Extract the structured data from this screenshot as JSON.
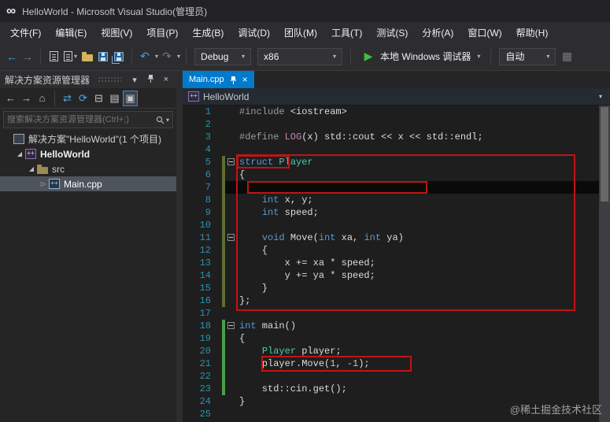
{
  "title_bar": {
    "app_title": "HelloWorld - Microsoft Visual Studio(管理员)"
  },
  "menu_bar": {
    "items": [
      "文件(F)",
      "编辑(E)",
      "视图(V)",
      "项目(P)",
      "生成(B)",
      "调试(D)",
      "团队(M)",
      "工具(T)",
      "测试(S)",
      "分析(A)",
      "窗口(W)",
      "帮助(H)"
    ]
  },
  "toolbar": {
    "debug_dropdown": "Debug",
    "platform_dropdown": "x86",
    "start_button": "本地 Windows 调试器",
    "auto_dropdown": "自动"
  },
  "solution_explorer": {
    "title": "解决方案资源管理器",
    "search_placeholder": "搜索解决方案资源管理器(Ctrl+;)",
    "tree": [
      {
        "id": "solution",
        "label": "解决方案\"HelloWorld\"(1 个项目)",
        "indent": 0,
        "icon": "solution",
        "expander": "none"
      },
      {
        "id": "project-helloworld",
        "label": "HelloWorld",
        "indent": 1,
        "icon": "project",
        "expander": "expanded",
        "bold": true
      },
      {
        "id": "folder-src",
        "label": "src",
        "indent": 2,
        "icon": "folder",
        "expander": "expanded"
      },
      {
        "id": "file-maincpp",
        "label": "Main.cpp",
        "indent": 3,
        "icon": "cpp",
        "expander": "collapsed",
        "selected": true
      }
    ]
  },
  "editor": {
    "tab_label": "Main.cpp",
    "breadcrumb": "HelloWorld",
    "code": {
      "lines": [
        {
          "n": 1,
          "tokens": [
            [
              "pp",
              "#include "
            ],
            [
              "d",
              "<iostream>"
            ]
          ]
        },
        {
          "n": 2,
          "tokens": []
        },
        {
          "n": 3,
          "tokens": [
            [
              "pp",
              "#define "
            ],
            [
              "macro",
              "LOG"
            ],
            [
              "d",
              "(x) std::cout << x << std::endl;"
            ]
          ]
        },
        {
          "n": 4,
          "tokens": []
        },
        {
          "n": 5,
          "fold": true,
          "bar": "b1",
          "tokens": [
            [
              "kw",
              "struct"
            ],
            [
              "d",
              " "
            ],
            [
              "type",
              "Player"
            ]
          ]
        },
        {
          "n": 6,
          "bar": "b1",
          "tokens": [
            [
              "d",
              "{"
            ]
          ]
        },
        {
          "n": 7,
          "bar": "b1",
          "cur": true,
          "tokens": []
        },
        {
          "n": 8,
          "bar": "b1",
          "tokens": [
            [
              "d",
              "    "
            ],
            [
              "kw",
              "int"
            ],
            [
              "d",
              " x, y;"
            ]
          ]
        },
        {
          "n": 9,
          "bar": "b1",
          "tokens": [
            [
              "d",
              "    "
            ],
            [
              "kw",
              "int"
            ],
            [
              "d",
              " speed;"
            ]
          ]
        },
        {
          "n": 10,
          "bar": "b1",
          "tokens": []
        },
        {
          "n": 11,
          "fold": true,
          "bar": "b1",
          "tokens": [
            [
              "d",
              "    "
            ],
            [
              "kw",
              "void"
            ],
            [
              "d",
              " Move("
            ],
            [
              "kw",
              "int"
            ],
            [
              "d",
              " xa, "
            ],
            [
              "kw",
              "int"
            ],
            [
              "d",
              " ya)"
            ]
          ]
        },
        {
          "n": 12,
          "bar": "b1",
          "tokens": [
            [
              "d",
              "    {"
            ]
          ]
        },
        {
          "n": 13,
          "bar": "b1",
          "tokens": [
            [
              "d",
              "        x += xa * speed;"
            ]
          ]
        },
        {
          "n": 14,
          "bar": "b1",
          "tokens": [
            [
              "d",
              "        y += ya * speed;"
            ]
          ]
        },
        {
          "n": 15,
          "bar": "b1",
          "tokens": [
            [
              "d",
              "    }"
            ]
          ]
        },
        {
          "n": 16,
          "bar": "b1",
          "tokens": [
            [
              "d",
              "};"
            ]
          ]
        },
        {
          "n": 17,
          "tokens": []
        },
        {
          "n": 18,
          "fold": true,
          "bar": "b2",
          "tokens": [
            [
              "kw",
              "int"
            ],
            [
              "d",
              " main()"
            ]
          ]
        },
        {
          "n": 19,
          "bar": "b2",
          "tokens": [
            [
              "d",
              "{"
            ]
          ]
        },
        {
          "n": 20,
          "bar": "b2",
          "tokens": [
            [
              "d",
              "    "
            ],
            [
              "type",
              "Player"
            ],
            [
              "d",
              " player;"
            ]
          ]
        },
        {
          "n": 21,
          "bar": "b2",
          "tokens": [
            [
              "d",
              "    player.Move("
            ],
            [
              "num",
              "1"
            ],
            [
              "d",
              ", "
            ],
            [
              "num",
              "-1"
            ],
            [
              "d",
              ");"
            ]
          ]
        },
        {
          "n": 22,
          "bar": "b2",
          "tokens": []
        },
        {
          "n": 23,
          "bar": "b2",
          "tokens": [
            [
              "d",
              "    std::cin.get();"
            ]
          ]
        },
        {
          "n": 24,
          "tokens": [
            [
              "d",
              "}"
            ]
          ]
        },
        {
          "n": 25,
          "tokens": []
        }
      ]
    }
  },
  "icons": {
    "vs_logo": "∞",
    "back_arrow": "←",
    "forward_arrow": "→",
    "home": "⌂",
    "sync": "⇄",
    "refresh": "⟳",
    "collapse_all": "⊟",
    "properties": "▤",
    "preview": "▣",
    "dropdown": "▾",
    "close": "×",
    "play": "▶",
    "undo": "↶",
    "redo": "↷",
    "overflow": "▦",
    "expander_expanded": "◢",
    "expander_collapsed": "▷",
    "cpp_marks": "++"
  },
  "watermark": "@稀土掘金技术社区"
}
